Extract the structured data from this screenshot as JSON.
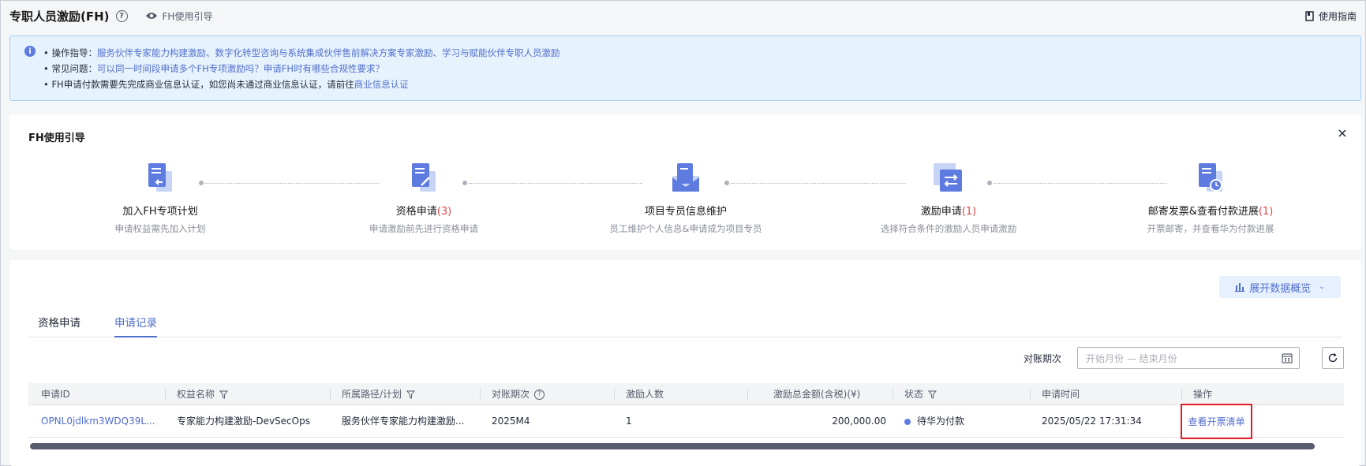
{
  "header": {
    "title": "专职人员激励(FH)",
    "guide_link": "FH使用引导",
    "usage_guide": "使用指南"
  },
  "notice": {
    "line1_prefix": "• 操作指导：",
    "line1_link": "服务伙伴专家能力构建激励、数字化转型咨询与系统集成伙伴售前解决方案专家激励、学习与赋能伙伴专职人员激励",
    "line2_prefix": "• 常见问题：",
    "line2_link": "可以同一时间段申请多个FH专项激励吗？申请FH时有哪些合规性要求？",
    "line3_prefix": "• FH申请付款需要先完成商业信息认证，如您尚未通过商业信息认证，请前往",
    "line3_link": "商业信息认证"
  },
  "guide": {
    "title": "FH使用引导",
    "steps": [
      {
        "label": "加入FH专项计划",
        "count": "",
        "desc": "申请权益需先加入计划",
        "icon": "join-plan-icon"
      },
      {
        "label": "资格申请",
        "count": "(3)",
        "desc": "申请激励前先进行资格申请",
        "icon": "qualification-icon"
      },
      {
        "label": "项目专员信息维护",
        "count": "",
        "desc": "员工维护个人信息&申请成为项目专员",
        "icon": "info-maintenance-icon"
      },
      {
        "label": "激励申请",
        "count": "(1)",
        "desc": "选择符合条件的激励人员申请激励",
        "icon": "incentive-apply-icon"
      },
      {
        "label": "邮寄发票&查看付款进展",
        "count": "(1)",
        "desc": "开票邮寄，并查看华为付款进展",
        "icon": "invoice-progress-icon"
      }
    ]
  },
  "overview_button": "展开数据概览",
  "tabs": [
    {
      "label": "资格申请",
      "active": false
    },
    {
      "label": "申请记录",
      "active": true
    }
  ],
  "filter": {
    "label": "对账期次",
    "placeholder": "开始月份 — 结束月份"
  },
  "table": {
    "columns": [
      "申请ID",
      "权益名称",
      "所属路径/计划",
      "对账期次",
      "激励人数",
      "激励总金额(含税)(¥)",
      "状态",
      "申请时间",
      "操作"
    ],
    "rows": [
      {
        "id": "OPNL0jdlkm3WDQ39L...",
        "benefit": "专家能力构建激励-DevSecOps",
        "path": "服务伙伴专家能力构建激励...",
        "period": "2025M4",
        "count": "1",
        "amount": "200,000.00",
        "status": "待华为付款",
        "time": "2025/05/22 17:31:34",
        "action": "查看开票清单"
      }
    ]
  },
  "colors": {
    "link": "#526ecc",
    "accent": "#5e7ce0",
    "highlight_border": "#e51c23",
    "step_count": "#e54545"
  }
}
